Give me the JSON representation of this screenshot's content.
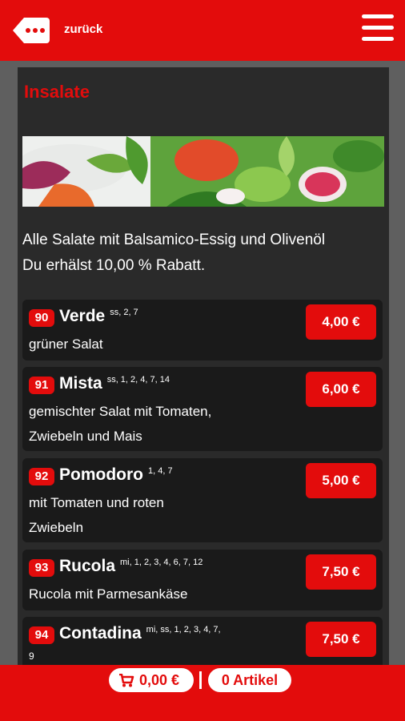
{
  "header": {
    "back_label": "zurück"
  },
  "section": {
    "title": "Insalate",
    "info_line1": "Alle Salate mit Balsamico-Essig und Olivenöl",
    "info_line2": "Du erhälst 10,00 % Rabatt."
  },
  "items": [
    {
      "number": "90",
      "name": "Verde",
      "allergens": "ss, 2, 7",
      "desc_line1": "grüner Salat",
      "desc_line2": "",
      "price": "4,00 €"
    },
    {
      "number": "91",
      "name": "Mista",
      "allergens": "ss, 1, 2, 4, 7, 14",
      "desc_line1": "gemischter Salat mit Tomaten,",
      "desc_line2": "Zwiebeln und Mais",
      "price": "6,00 €"
    },
    {
      "number": "92",
      "name": "Pomodoro",
      "allergens": "1, 4, 7",
      "desc_line1": "mit Tomaten und roten",
      "desc_line2": "Zwiebeln",
      "price": "5,00 €"
    },
    {
      "number": "93",
      "name": "Rucola",
      "allergens": "mi, 1, 2, 3, 4, 6, 7, 12",
      "desc_line1": "Rucola mit Parmesankäse",
      "desc_line2": "",
      "price": "7,50 €"
    },
    {
      "number": "94",
      "name": "Contadina",
      "allergens": "mi, ss, 1, 2, 3, 4, 7,",
      "desc_line1": "9",
      "desc_line2": "",
      "price": "7,50 €"
    }
  ],
  "footer": {
    "cart_total": "0,00 €",
    "article_count": "0 Artikel"
  },
  "icons": {
    "back": "back-chat-icon",
    "menu": "hamburger-menu-icon",
    "cart": "cart-icon"
  },
  "colors": {
    "accent": "#e30c0c",
    "panel": "#2a2a2a",
    "item_bg": "#1a1a1a"
  }
}
